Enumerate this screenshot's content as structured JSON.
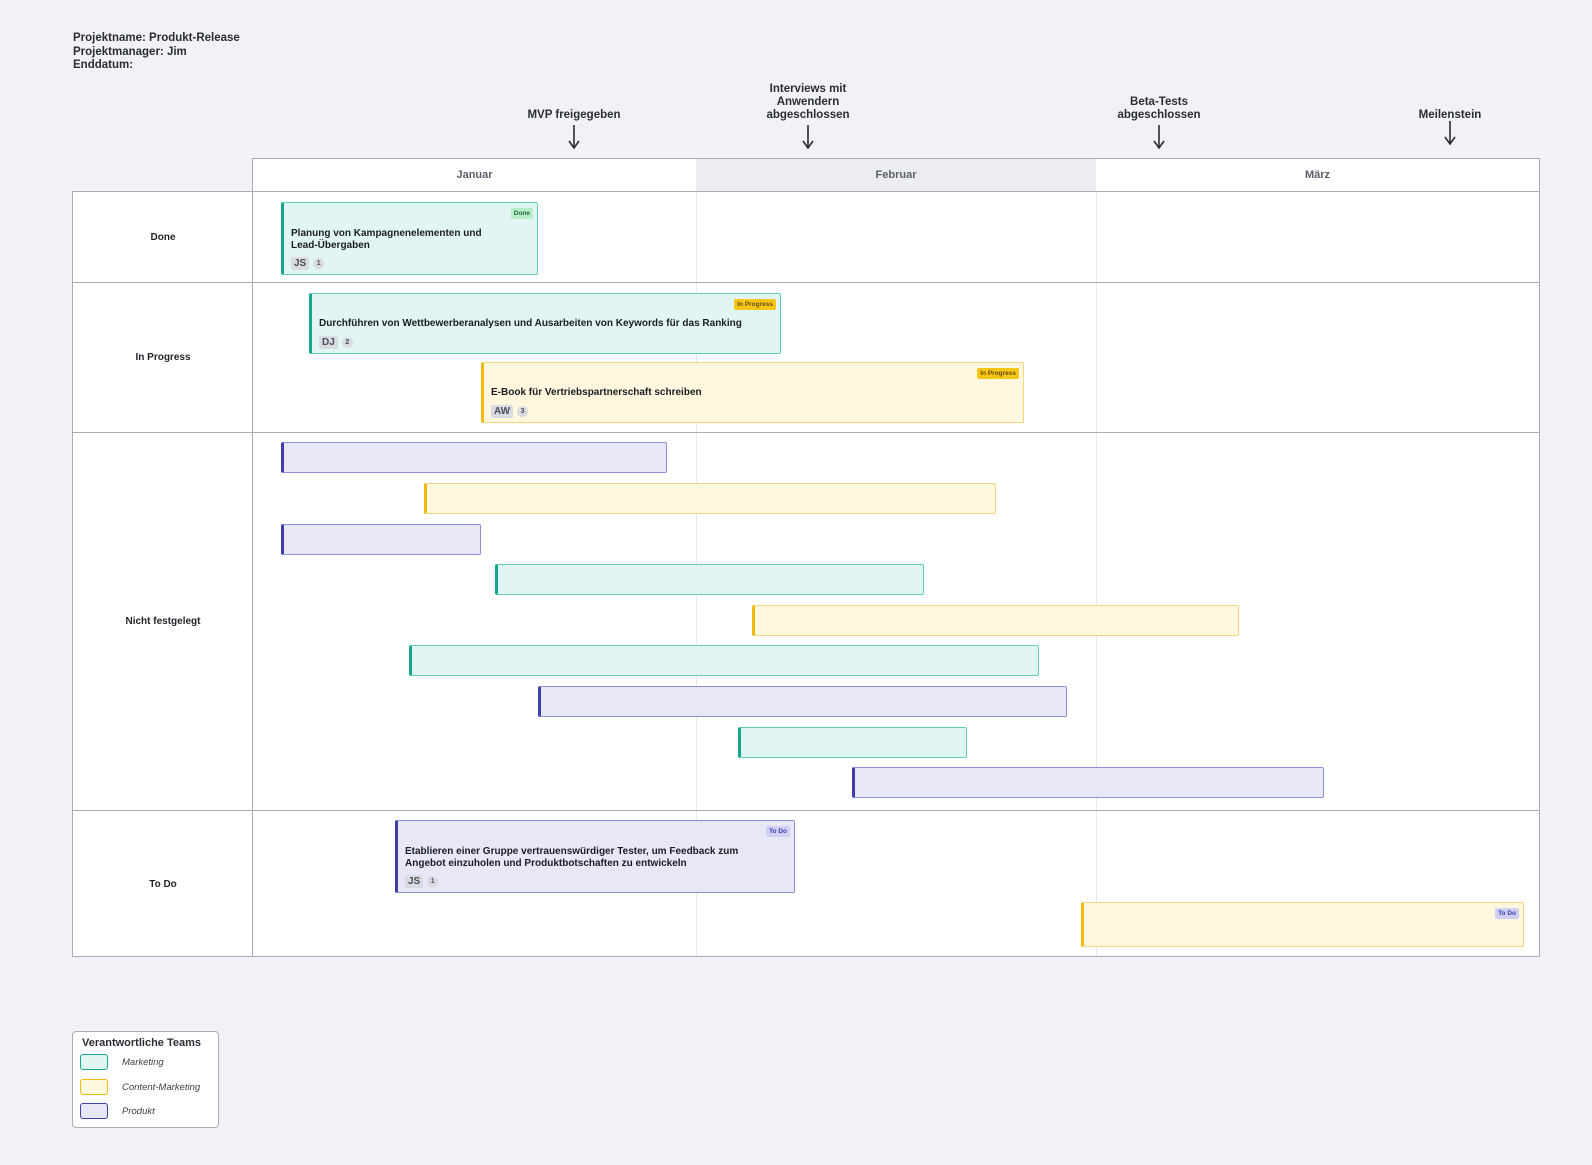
{
  "project": {
    "name_line": "Projektname: Produkt-Release",
    "manager_line": "Projektmanager: Jim",
    "end_line": "Enddatum:"
  },
  "milestones": [
    {
      "label": "MVP freigegeben"
    },
    {
      "label": "Interviews mit Anwendern abgeschlossen"
    },
    {
      "label": "Beta-Tests abgeschlossen"
    },
    {
      "label": "Meilenstein"
    }
  ],
  "months": [
    "Januar",
    "Februar",
    "März"
  ],
  "lanes": [
    {
      "label": "Done"
    },
    {
      "label": "In Progress"
    },
    {
      "label": "Nicht festgelegt"
    },
    {
      "label": "To Do"
    }
  ],
  "cards": {
    "done1": {
      "title": "Planung von Kampagnenelementen und Lead-Übergaben",
      "initials": "JS",
      "count": "1",
      "badge": "Done",
      "team": "Marketing"
    },
    "prog1": {
      "title": "Durchführen von Wettbewerberanalysen und Ausarbeiten von Keywords für das Ranking",
      "initials": "DJ",
      "count": "2",
      "badge": "In Progress",
      "team": "Marketing"
    },
    "prog2": {
      "title": "E-Book für Vertriebspartnerschaft schreiben",
      "initials": "AW",
      "count": "3",
      "badge": "In Progress",
      "team": "Content-Marketing"
    },
    "todo1": {
      "title": "Etablieren einer Gruppe vertrauenswürdiger Tester, um Feedback zum Angebot einzuholen und Produktbotschaften zu entwickeln",
      "initials": "JS",
      "count": "1",
      "badge": "To Do",
      "team": "Produkt"
    },
    "todo2": {
      "badge": "To Do",
      "team": "Content-Marketing"
    }
  },
  "unassigned_bars": [
    {
      "team": "Produkt"
    },
    {
      "team": "Content-Marketing"
    },
    {
      "team": "Produkt"
    },
    {
      "team": "Marketing"
    },
    {
      "team": "Content-Marketing"
    },
    {
      "team": "Marketing"
    },
    {
      "team": "Produkt"
    },
    {
      "team": "Marketing"
    },
    {
      "team": "Produkt"
    }
  ],
  "legend": {
    "title": "Verantwortliche Teams",
    "items": [
      {
        "label": "Marketing",
        "color": "#16a68b"
      },
      {
        "label": "Content-Marketing",
        "color": "#f2b90f"
      },
      {
        "label": "Produkt",
        "color": "#3e3fad"
      }
    ]
  },
  "colors": {
    "marketing": "#16a68b",
    "content_marketing": "#f2b90f",
    "produkt": "#3e3fad",
    "background": "#f1f2f5"
  },
  "icons": {
    "milestone_marker": "arrow-down-icon"
  }
}
